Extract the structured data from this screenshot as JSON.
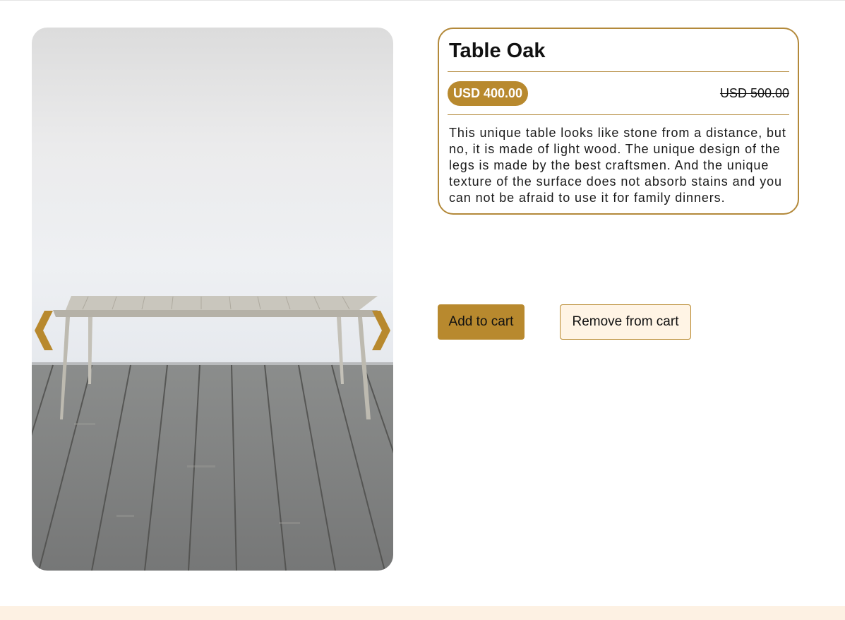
{
  "product": {
    "title": "Table Oak",
    "price": "USD 400.00",
    "old_price": "USD 500.00",
    "description": "This unique table looks like stone from a distance, but no, it is made of light wood. The unique design of the legs is made by the best craftsmen. And the unique texture of the surface does not absorb stains and you can not be afraid to use it for family dinners."
  },
  "gallery": {
    "prev_icon": "chevron-left-icon",
    "next_icon": "chevron-right-icon"
  },
  "actions": {
    "add_label": "Add to cart",
    "remove_label": "Remove from cart"
  },
  "colors": {
    "accent": "#b8892e",
    "card_border": "#b3893a",
    "remove_bg": "#fff4e5",
    "footer_bg": "#fdf1e3"
  }
}
